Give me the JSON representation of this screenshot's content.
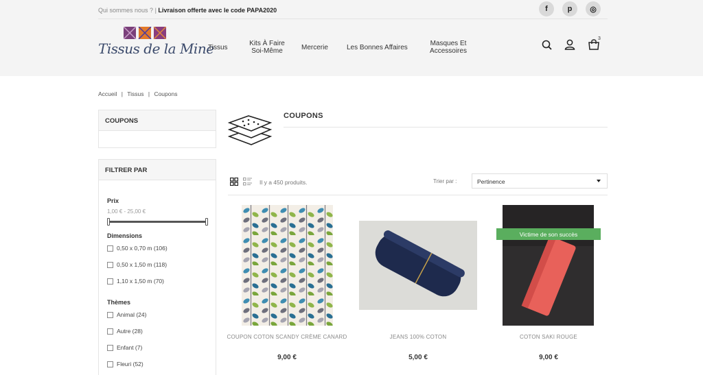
{
  "topbar": {
    "about": "Qui sommes nous ?",
    "separator": "|",
    "promo": "Livraison offerte avec le code PAPA2020",
    "social": [
      {
        "icon": "facebook-icon",
        "glyph": "f"
      },
      {
        "icon": "pinterest-icon",
        "glyph": "p"
      },
      {
        "icon": "instagram-icon",
        "glyph": "◎"
      }
    ]
  },
  "logo": {
    "text": "Tissus de la Mine",
    "square_colors": [
      "#7a3f7a",
      "#e2792a",
      "#8a3d7e"
    ]
  },
  "nav": {
    "items": [
      "Tissus",
      "Kits À Faire\nSoi-Même",
      "Mercerie",
      "Les Bonnes Affaires",
      "Masques Et\nAccessoires"
    ],
    "cart_count": "3"
  },
  "breadcrumb": {
    "items": [
      "Accueil",
      "Tissus",
      "Coupons"
    ],
    "separator": "|"
  },
  "sidebar": {
    "category_title": "COUPONS",
    "filter_title": "FILTRER PAR",
    "price": {
      "label": "Prix",
      "range": "1,00 € - 25,00 €"
    },
    "dimensions": {
      "label": "Dimensions",
      "options": [
        "0,50 x 0,70 m (106)",
        "0,50 x 1,50 m (118)",
        "1,10 x 1,50 m (70)"
      ]
    },
    "themes": {
      "label": "Thèmes",
      "options": [
        "Animal (24)",
        "Autre (28)",
        "Enfant (7)",
        "Fleuri (52)"
      ]
    }
  },
  "main": {
    "title": "COUPONS",
    "count": "Il y a 450 produits.",
    "sort_label": "Trier par :",
    "sort_value": "Pertinence",
    "products": [
      {
        "name": "COUPON COTON SCANDY CRÈME CANARD",
        "price": "9,00 €"
      },
      {
        "name": "JEANS 100% COTON",
        "price": "5,00 €"
      },
      {
        "name": "COTON SAKI ROUGE",
        "price": "9,00 €",
        "badge": "Victime de son succès"
      }
    ]
  },
  "colors": {
    "badge": "#5aae5e",
    "header_bg": "#f4f4f4",
    "logo_text": "#3b4a6b"
  }
}
